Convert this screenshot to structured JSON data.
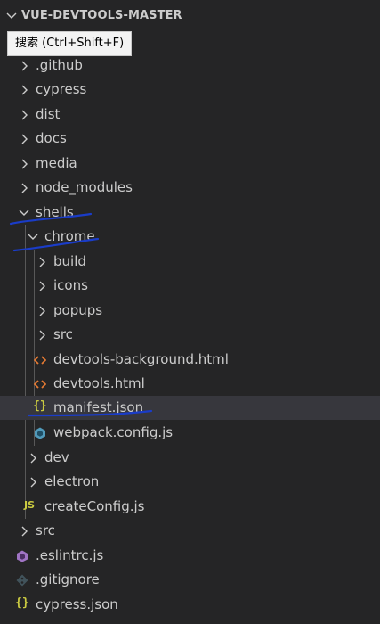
{
  "explorer": {
    "title": "VUE-DEVTOOLS-MASTER",
    "tooltip": "搜索 (Ctrl+Shift+F)",
    "items": [
      {
        "label": ".github",
        "kind": "folder",
        "expanded": false
      },
      {
        "label": "cypress",
        "kind": "folder",
        "expanded": false
      },
      {
        "label": "dist",
        "kind": "folder",
        "expanded": false
      },
      {
        "label": "docs",
        "kind": "folder",
        "expanded": false
      },
      {
        "label": "media",
        "kind": "folder",
        "expanded": false
      },
      {
        "label": "node_modules",
        "kind": "folder",
        "expanded": false
      },
      {
        "label": "shells",
        "kind": "folder",
        "expanded": true
      },
      {
        "label": "chrome",
        "kind": "folder",
        "expanded": true
      },
      {
        "label": "build",
        "kind": "folder",
        "expanded": false
      },
      {
        "label": "icons",
        "kind": "folder",
        "expanded": false
      },
      {
        "label": "popups",
        "kind": "folder",
        "expanded": false
      },
      {
        "label": "src",
        "kind": "folder",
        "expanded": false
      },
      {
        "label": "devtools-background.html",
        "kind": "file",
        "icon": "html-icon"
      },
      {
        "label": "devtools.html",
        "kind": "file",
        "icon": "html-icon"
      },
      {
        "label": "manifest.json",
        "kind": "file",
        "icon": "json-icon",
        "selected": true
      },
      {
        "label": "webpack.config.js",
        "kind": "file",
        "icon": "webpack-icon"
      },
      {
        "label": "dev",
        "kind": "folder",
        "expanded": false
      },
      {
        "label": "electron",
        "kind": "folder",
        "expanded": false
      },
      {
        "label": "createConfig.js",
        "kind": "file",
        "icon": "js-icon"
      },
      {
        "label": "src",
        "kind": "folder",
        "expanded": false
      },
      {
        "label": ".eslintrc.js",
        "kind": "file",
        "icon": "eslint-icon"
      },
      {
        "label": ".gitignore",
        "kind": "file",
        "icon": "git-icon"
      },
      {
        "label": "cypress.json",
        "kind": "file",
        "icon": "json-icon"
      }
    ]
  },
  "icon_glyphs": {
    "json": "{}",
    "js": "JS"
  },
  "colors": {
    "background": "#252526",
    "text": "#cccccc",
    "selected_row": "#37373d",
    "html_icon": "#e37933",
    "json_icon": "#cbcb41",
    "js_icon": "#cbcb41",
    "webpack_icon": "#519aba",
    "eslint_icon": "#a074c4",
    "git_icon": "#41535b",
    "annotation": "#1a3cc8"
  }
}
